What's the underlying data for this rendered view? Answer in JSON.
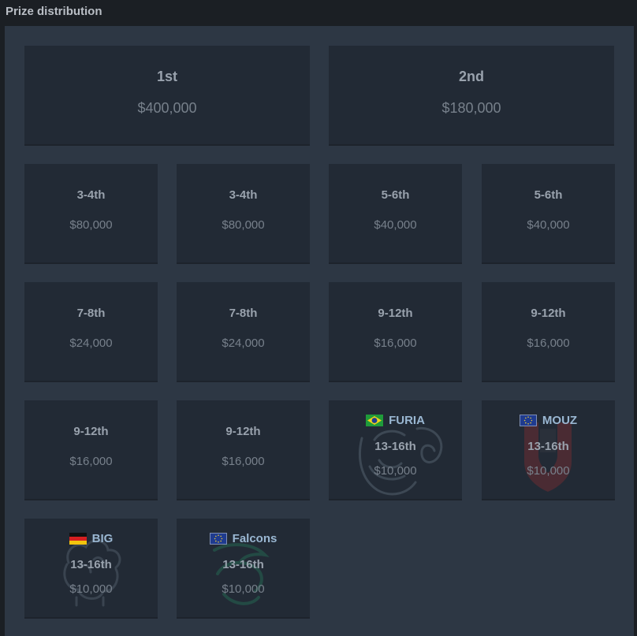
{
  "section": {
    "title": "Prize distribution"
  },
  "top": [
    {
      "place": "1st",
      "amount": "$400,000"
    },
    {
      "place": "2nd",
      "amount": "$180,000"
    }
  ],
  "grid": [
    {
      "place": "3-4th",
      "amount": "$80,000"
    },
    {
      "place": "3-4th",
      "amount": "$80,000"
    },
    {
      "place": "5-6th",
      "amount": "$40,000"
    },
    {
      "place": "5-6th",
      "amount": "$40,000"
    },
    {
      "place": "7-8th",
      "amount": "$24,000"
    },
    {
      "place": "7-8th",
      "amount": "$24,000"
    },
    {
      "place": "9-12th",
      "amount": "$16,000"
    },
    {
      "place": "9-12th",
      "amount": "$16,000"
    },
    {
      "place": "9-12th",
      "amount": "$16,000"
    },
    {
      "place": "9-12th",
      "amount": "$16,000"
    },
    {
      "team": "FURIA",
      "flag": "brazil",
      "logo_icon": "furia-panther-icon",
      "place": "13-16th",
      "amount": "$10,000"
    },
    {
      "team": "MOUZ",
      "flag": "eu",
      "logo_icon": "mouz-mouse-icon",
      "place": "13-16th",
      "amount": "$10,000"
    },
    {
      "team": "BIG",
      "flag": "germany",
      "logo_icon": "big-brain-icon",
      "place": "13-16th",
      "amount": "$10,000"
    },
    {
      "team": "Falcons",
      "flag": "eu",
      "logo_icon": "falcons-bird-icon",
      "place": "13-16th",
      "amount": "$10,000"
    }
  ],
  "colors": {
    "background": "#1b1f24",
    "panel": "#2d3744",
    "card": "#222a35",
    "place_text": "#99a2ad",
    "amount_text": "#77808b",
    "team_text": "#9ab7d2"
  }
}
